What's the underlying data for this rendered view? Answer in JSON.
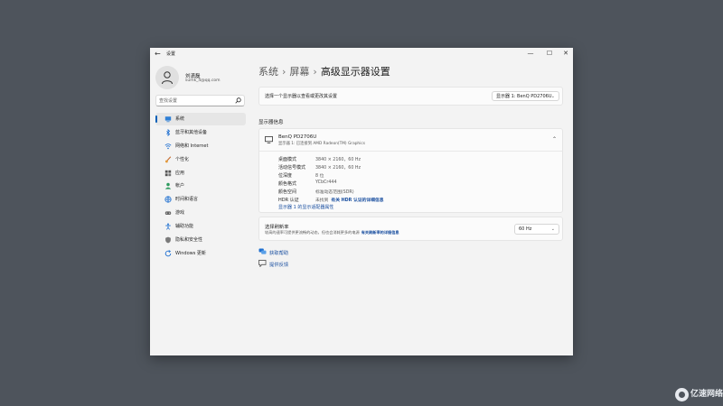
{
  "window": {
    "title": "设置",
    "controls": {
      "minimize": "—",
      "maximize": "☐",
      "close": "✕"
    }
  },
  "user": {
    "name": "刘潇磊",
    "email": "sumk_4@qq.com"
  },
  "search": {
    "placeholder": "查找设置"
  },
  "sidebar": {
    "items": [
      {
        "label": "系统",
        "icon": "system-icon",
        "active": true
      },
      {
        "label": "蓝牙和其他设备",
        "icon": "bluetooth-icon"
      },
      {
        "label": "网络和 Internet",
        "icon": "wifi-icon"
      },
      {
        "label": "个性化",
        "icon": "brush-icon"
      },
      {
        "label": "应用",
        "icon": "apps-icon"
      },
      {
        "label": "帐户",
        "icon": "account-icon"
      },
      {
        "label": "时间和语言",
        "icon": "globe-icon"
      },
      {
        "label": "游戏",
        "icon": "gamepad-icon"
      },
      {
        "label": "辅助功能",
        "icon": "accessibility-icon"
      },
      {
        "label": "隐私和安全性",
        "icon": "shield-icon"
      },
      {
        "label": "Windows 更新",
        "icon": "update-icon"
      }
    ]
  },
  "breadcrumb": {
    "parent1": "系统",
    "parent2": "屏幕",
    "current": "高级显示器设置",
    "separator": "›"
  },
  "select_display": {
    "label": "选择一个显示器以查看或更改其设置",
    "value": "显示器 1: BenQ PD2706U"
  },
  "display_info": {
    "section_title": "显示器信息",
    "monitor_name": "BenQ PD2706U",
    "monitor_sub": "显示器 1: 已连接到 AMD Radeon(TM) Graphics",
    "properties": [
      {
        "key": "桌面模式",
        "value": "3840 × 2160，60 Hz"
      },
      {
        "key": "活动信号模式",
        "value": "3840 × 2160，60 Hz"
      },
      {
        "key": "位深度",
        "value": "8 位"
      },
      {
        "key": "颜色格式",
        "value": "YCbCr444"
      },
      {
        "key": "颜色空间",
        "value": "标准动态范围(SDR)"
      },
      {
        "key": "HDR 认证",
        "value": "未找到",
        "link": "有关 HDR 认证的详细信息"
      }
    ],
    "adapter_link": "显示器 1 的显示适配器属性"
  },
  "refresh": {
    "title": "选择刷新率",
    "description": "较高的速率可提供更流畅的动态，但也会消耗更多的电源",
    "link": "有关刷新率的详细信息",
    "value": "60 Hz"
  },
  "help": {
    "get_help": "获取帮助",
    "feedback": "提供反馈"
  },
  "watermark": {
    "text": "亿速网络"
  }
}
